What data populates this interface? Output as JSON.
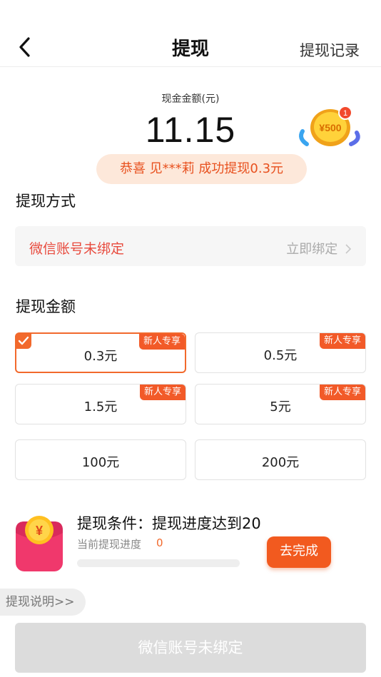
{
  "nav": {
    "title": "提现",
    "right_label": "提现记录"
  },
  "cash": {
    "label": "现金金额(元)",
    "amount": "11.15"
  },
  "coin_badge": {
    "text": "¥500",
    "count": "1"
  },
  "ticker": {
    "text": "恭喜 见***莉 成功提现0.3元"
  },
  "method": {
    "title": "提现方式",
    "status": "微信账号未绑定",
    "action": "立即绑定"
  },
  "amounts": {
    "title": "提现金额",
    "options": [
      {
        "label": "0.3元",
        "tag": "新人专享",
        "selected": true
      },
      {
        "label": "0.5元",
        "tag": "新人专享",
        "selected": false
      },
      {
        "label": "1.5元",
        "tag": "新人专享",
        "selected": false
      },
      {
        "label": "5元",
        "tag": "新人专享",
        "selected": false
      },
      {
        "label": "100元",
        "tag": "",
        "selected": false
      },
      {
        "label": "200元",
        "tag": "",
        "selected": false
      }
    ]
  },
  "condition": {
    "title": "提现条件：提现进度达到20",
    "progress_label": "当前提现进度",
    "progress_value": "0",
    "progress_fraction": 0,
    "button": "去完成"
  },
  "explain_link": "提现说明>>",
  "submit": {
    "label": "微信账号未绑定"
  },
  "colors": {
    "accent": "#f2692c",
    "warning": "#e84a3d",
    "disabled": "#dcdcdc"
  }
}
